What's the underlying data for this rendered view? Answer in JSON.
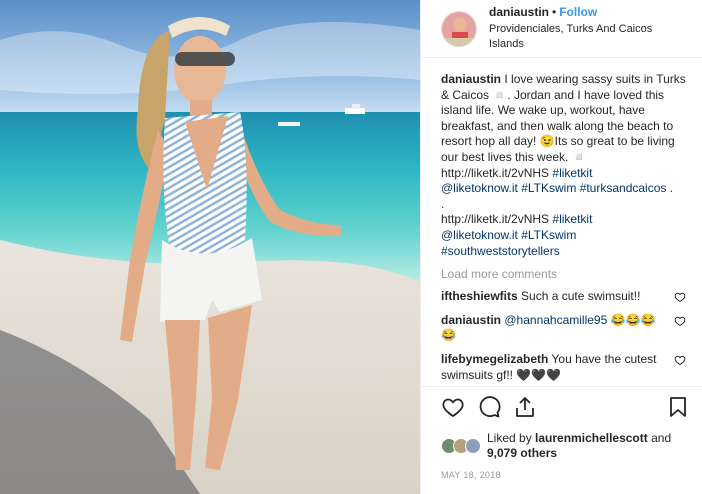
{
  "header": {
    "username": "daniaustin",
    "separator": "•",
    "follow_label": "Follow",
    "location": "Providenciales, Turks And Caicos Islands"
  },
  "caption": {
    "username": "daniaustin",
    "line1": "I love wearing sassy suits in Turks & Caicos ◽. Jordan and I have loved this island life. We wake up, workout, have breakfast, and then walk along the beach to resort hop all day! 😉Its so great to be living our best lives this week. ◽",
    "link1": "http://liketk.it/2vNHS",
    "tags1a": "#liketkit",
    "tags1b": "@liketoknow.it #LTKswim #turksandcaicos",
    "dot1": ".",
    "dot2": ".",
    "link2": "http://liketk.it/2vNHS",
    "tags2a": "#liketkit",
    "tags2b": "@liketoknow.it #LTKswim",
    "tags2c": "#southweststorytellers"
  },
  "load_more": "Load more comments",
  "comments": [
    {
      "user": "iftheshiewfits",
      "text": "Such a cute swimsuit!!",
      "mention": ""
    },
    {
      "user": "daniaustin",
      "text": "😂😂😂😂",
      "mention": "@hannahcamille95"
    },
    {
      "user": "lifebymegelizabeth",
      "text": "You have the cutest swimsuits gf!! 🖤🖤🖤",
      "mention": ""
    }
  ],
  "likes": {
    "prefix": "Liked by",
    "user": "laurenmichellescott",
    "and": "and",
    "count": "9,079 others"
  },
  "date": "MAY 18, 2018",
  "icons": {
    "like": "heart-icon",
    "comment": "comment-icon",
    "share": "share-icon",
    "save": "bookmark-icon"
  },
  "colors": {
    "link": "#003569",
    "follow": "#3897f0",
    "muted": "#999999"
  }
}
